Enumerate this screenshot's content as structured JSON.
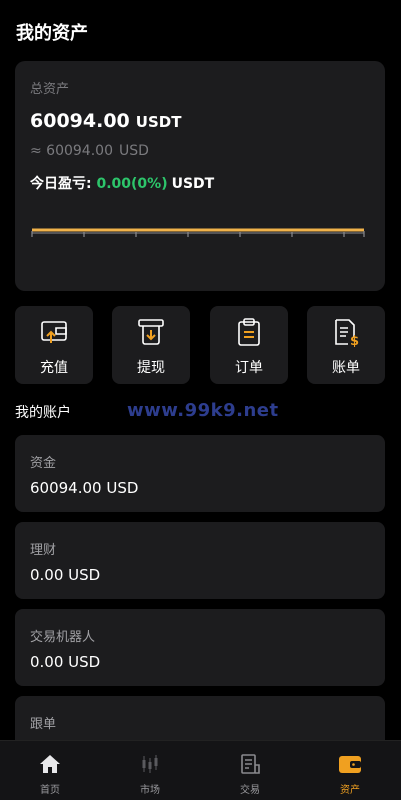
{
  "header": {
    "title": "我的资产"
  },
  "summary": {
    "total_label": "总资产",
    "total_value": "60094.00",
    "total_unit": "USDT",
    "approx_value": "≈ 60094.00",
    "approx_unit": "USD",
    "pnl_label": "今日盈亏:",
    "pnl_value": "0.00(0%)",
    "pnl_unit": "USDT",
    "chart_color": "#f0b24a"
  },
  "actions": [
    {
      "label": "充值",
      "icon": "deposit-icon"
    },
    {
      "label": "提现",
      "icon": "withdraw-icon"
    },
    {
      "label": "订单",
      "icon": "order-clipboard-icon"
    },
    {
      "label": "账单",
      "icon": "bill-icon"
    }
  ],
  "accounts_title": "我的账户",
  "watermark": "www.99k9.net",
  "accounts": [
    {
      "name": "资金",
      "value": "60094.00 USD"
    },
    {
      "name": "理财",
      "value": "0.00 USD"
    },
    {
      "name": "交易机器人",
      "value": "0.00 USD"
    },
    {
      "name": "跟单",
      "value": ""
    }
  ],
  "tabs": [
    {
      "label": "首页",
      "icon": "home-icon"
    },
    {
      "label": "市场",
      "icon": "candlestick-icon"
    },
    {
      "label": "交易",
      "icon": "trade-document-icon"
    },
    {
      "label": "资产",
      "icon": "wallet-icon",
      "active": true
    }
  ],
  "colors": {
    "accent": "#f0a020",
    "positive": "#2dc56b",
    "card": "#1c1c1e"
  }
}
